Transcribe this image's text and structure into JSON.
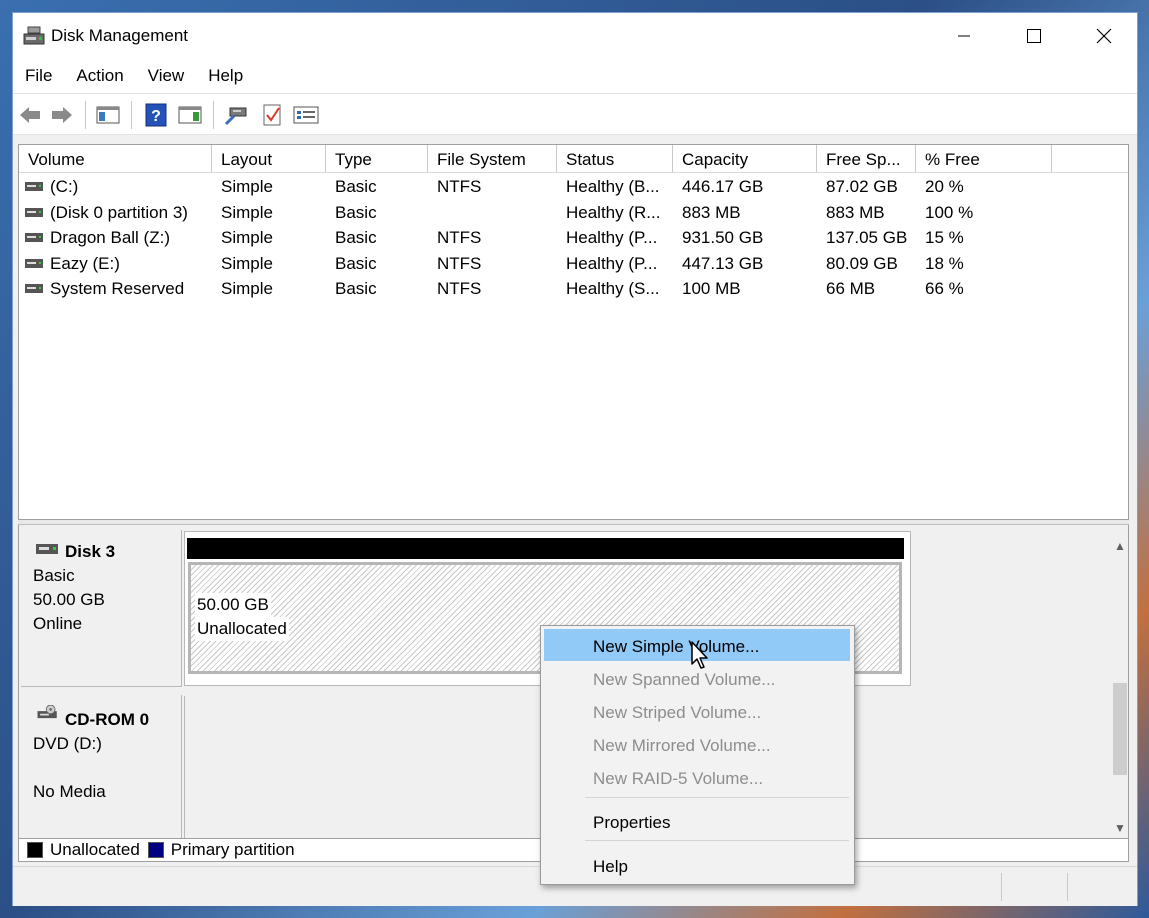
{
  "window": {
    "title": "Disk Management",
    "controls": {
      "minimize": "—",
      "maximize": "☐",
      "close": "✕"
    }
  },
  "menubar": [
    "File",
    "Action",
    "View",
    "Help"
  ],
  "toolbar": {
    "icons": [
      "back-arrow-icon",
      "forward-arrow-icon",
      "console-tree-icon",
      "help-icon",
      "action-pane-icon",
      "connect-icon",
      "checklist-icon",
      "properties-list-icon"
    ]
  },
  "volume_table": {
    "columns": [
      "Volume",
      "Layout",
      "Type",
      "File System",
      "Status",
      "Capacity",
      "Free Sp...",
      "% Free",
      ""
    ],
    "rows": [
      {
        "volume": " (C:)",
        "layout": "Simple",
        "type": "Basic",
        "fs": "NTFS",
        "status": "Healthy (B...",
        "capacity": "446.17 GB",
        "free": "87.02 GB",
        "pct": "20 %"
      },
      {
        "volume": "(Disk 0 partition 3)",
        "layout": "Simple",
        "type": "Basic",
        "fs": "",
        "status": "Healthy (R...",
        "capacity": "883 MB",
        "free": "883 MB",
        "pct": "100 %"
      },
      {
        "volume": "Dragon Ball (Z:)",
        "layout": "Simple",
        "type": "Basic",
        "fs": "NTFS",
        "status": "Healthy (P...",
        "capacity": "931.50 GB",
        "free": "137.05 GB",
        "pct": "15 %"
      },
      {
        "volume": "Eazy (E:)",
        "layout": "Simple",
        "type": "Basic",
        "fs": "NTFS",
        "status": "Healthy (P...",
        "capacity": "447.13 GB",
        "free": "80.09 GB",
        "pct": "18 %"
      },
      {
        "volume": "System Reserved",
        "layout": "Simple",
        "type": "Basic",
        "fs": "NTFS",
        "status": "Healthy (S...",
        "capacity": "100 MB",
        "free": "66 MB",
        "pct": "66 %"
      }
    ]
  },
  "disks": {
    "disk3": {
      "name": "Disk 3",
      "type": "Basic",
      "size": "50.00 GB",
      "state": "Online",
      "partition_size": "50.00 GB",
      "partition_label": "Unallocated"
    },
    "cdrom0": {
      "name": "CD-ROM 0",
      "type": "DVD (D:)",
      "state": "No Media"
    }
  },
  "legend": {
    "unallocated": {
      "label": "Unallocated",
      "color": "#000000"
    },
    "primary": {
      "label": "Primary partition",
      "color": "#000080"
    }
  },
  "context_menu": {
    "items": [
      {
        "label": "New Simple Volume...",
        "enabled": true,
        "highlighted": true
      },
      {
        "label": "New Spanned Volume...",
        "enabled": false
      },
      {
        "label": "New Striped Volume...",
        "enabled": false
      },
      {
        "label": "New Mirrored Volume...",
        "enabled": false
      },
      {
        "label": "New RAID-5 Volume...",
        "enabled": false
      },
      {
        "label": "Properties",
        "enabled": true
      },
      {
        "label": "Help",
        "enabled": true
      }
    ]
  },
  "colors": {
    "highlight": "#91c9f7",
    "disabled_text": "#8d8d8d",
    "window_border": "#7aa0cc"
  }
}
